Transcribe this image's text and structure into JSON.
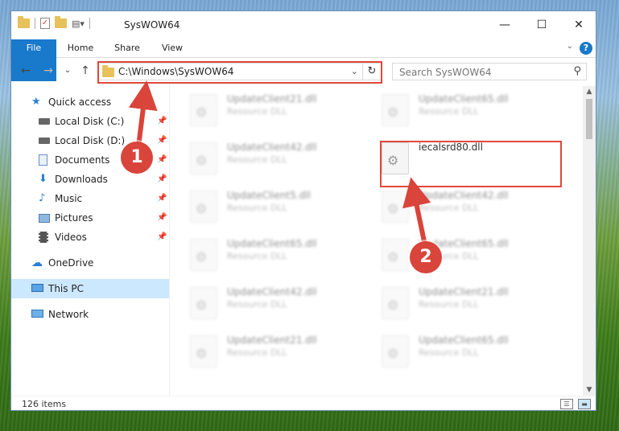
{
  "window": {
    "title": "SysWOW64",
    "minimize": "—",
    "maximize": "☐",
    "close": "✕"
  },
  "ribbon": {
    "tabs": [
      "File",
      "Home",
      "Share",
      "View"
    ],
    "help": "?",
    "collapse": "⌄"
  },
  "nav": {
    "back": "←",
    "forward": "→",
    "recent": "⌄",
    "up": "↑",
    "address": "C:\\Windows\\SysWOW64",
    "refresh": "↻",
    "search_placeholder": "Search SysWOW64",
    "search_icon": "⚲"
  },
  "sidebar": [
    {
      "label": "Quick access",
      "icon": "star-icon",
      "pinned": false
    },
    {
      "label": "Local Disk (C:)",
      "icon": "drive-icon",
      "pinned": true
    },
    {
      "label": "Local Disk (D:)",
      "icon": "drive-icon",
      "pinned": true
    },
    {
      "label": "Documents",
      "icon": "documents-icon",
      "pinned": true
    },
    {
      "label": "Downloads",
      "icon": "download-icon",
      "pinned": true
    },
    {
      "label": "Music",
      "icon": "music-icon",
      "pinned": true
    },
    {
      "label": "Pictures",
      "icon": "pictures-icon",
      "pinned": true
    },
    {
      "label": "Videos",
      "icon": "videos-icon",
      "pinned": true
    },
    {
      "label": "OneDrive",
      "icon": "cloud-icon",
      "pinned": false
    },
    {
      "label": "This PC",
      "icon": "computer-icon",
      "pinned": false,
      "selected": true
    },
    {
      "label": "Network",
      "icon": "network-icon",
      "pinned": false
    }
  ],
  "files": {
    "left": [
      {
        "name": "UpdateClient21.dll",
        "desc": "Resource DLL"
      },
      {
        "name": "UpdateClient42.dll",
        "desc": "Resource DLL"
      },
      {
        "name": "UpdateClient5.dll",
        "desc": "Resource DLL"
      },
      {
        "name": "UpdateClient65.dll",
        "desc": "Resource DLL"
      },
      {
        "name": "UpdateClient42.dll",
        "desc": "Resource DLL"
      },
      {
        "name": "UpdateClient21.dll",
        "desc": "Resource DLL"
      }
    ],
    "right": [
      {
        "name": "UpdateClient65.dll",
        "desc": "Resource DLL"
      },
      {
        "name": "iecalsrd80.dll",
        "desc": ""
      },
      {
        "name": "UpdateClient42.dll",
        "desc": "Resource DLL"
      },
      {
        "name": "UpdateClient65.dll",
        "desc": "Resource DLL"
      },
      {
        "name": "UpdateClient21.dll",
        "desc": "Resource DLL"
      },
      {
        "name": "UpdateClient65.dll",
        "desc": "Resource DLL"
      }
    ]
  },
  "status": {
    "items": "126 items"
  },
  "annotations": {
    "marker1": "1",
    "marker2": "2",
    "color": "#d9443b"
  }
}
